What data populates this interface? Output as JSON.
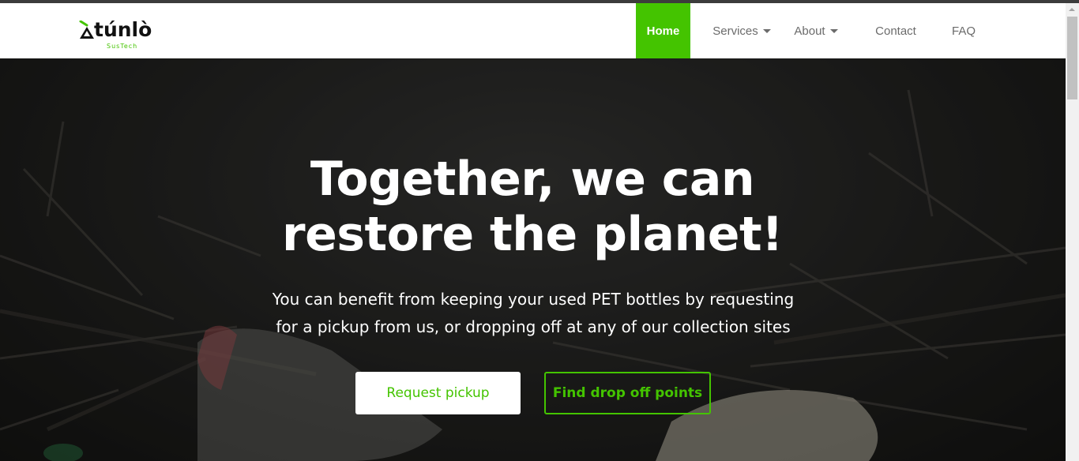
{
  "brand": {
    "name": "túnlò",
    "sub": "SusTech",
    "accent_color": "#44c400",
    "mark_icon": "recycle-arrow-icon"
  },
  "nav": {
    "items": [
      {
        "label": "Home",
        "active": true
      },
      {
        "label": "Services",
        "dropdown": true
      },
      {
        "label": "About",
        "dropdown": true
      },
      {
        "label": "Contact"
      },
      {
        "label": "FAQ"
      }
    ]
  },
  "hero": {
    "title_line1": "Together, we can",
    "title_line2": "restore the planet!",
    "subtitle_line1": "You can benefit from keeping your used PET bottles by requesting",
    "subtitle_line2": "for a pickup from us, or dropping off at any of our collection sites",
    "primary_button": "Request pickup",
    "secondary_button": "Find drop off points"
  }
}
